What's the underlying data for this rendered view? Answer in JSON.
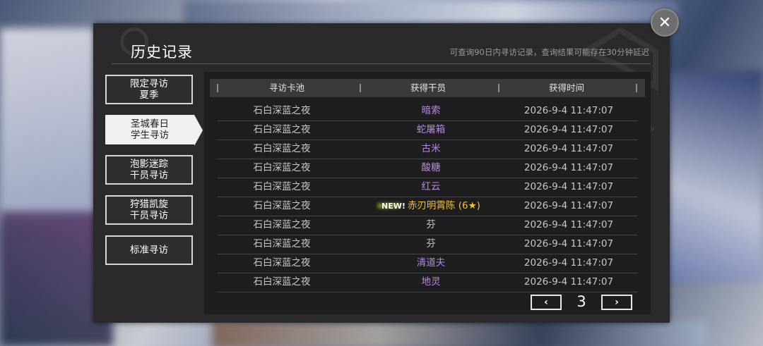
{
  "header": {
    "title": "历史记录",
    "hint": "可查询90日内寻访记录，查询结果可能存在30分钟延迟"
  },
  "close_icon": "✕",
  "tabs": [
    {
      "line1": "限定寻访",
      "line2": "夏季",
      "active": false
    },
    {
      "line1": "圣城春日",
      "line2": "学生寻访",
      "active": true
    },
    {
      "line1": "泡影迷踪",
      "line2": "干员寻访",
      "active": false
    },
    {
      "line1": "狩猎凯旋",
      "line2": "干员寻访",
      "active": false
    },
    {
      "line1": "标准寻访",
      "line2": "",
      "active": false
    }
  ],
  "table": {
    "headers": {
      "pool": "寻访卡池",
      "operator": "获得干员",
      "time": "获得时间"
    },
    "rows": [
      {
        "pool": "石白深蓝之夜",
        "operator": "暗索",
        "time": "2026-9-4 11:47:07"
      },
      {
        "pool": "石白深蓝之夜",
        "operator": "蛇屠箱",
        "time": "2026-9-4 11:47:07"
      },
      {
        "pool": "石白深蓝之夜",
        "operator": "古米",
        "time": "2026-9-4 11:47:07"
      },
      {
        "pool": "石白深蓝之夜",
        "operator": "酸糖",
        "time": "2026-9-4 11:47:07"
      },
      {
        "pool": "石白深蓝之夜",
        "operator": "红云",
        "time": "2026-9-4 11:47:07"
      },
      {
        "pool": "石白深蓝之夜",
        "operator": "赤刃明霄陈 (6★)",
        "time": "2026-9-4 11:47:07",
        "new": "NEW!"
      },
      {
        "pool": "石白深蓝之夜",
        "operator": "芬",
        "time": "2026-9-4 11:47:07"
      },
      {
        "pool": "石白深蓝之夜",
        "operator": "芬",
        "time": "2026-9-4 11:47:07"
      },
      {
        "pool": "石白深蓝之夜",
        "operator": "清道夫",
        "time": "2026-9-4 11:47:07"
      },
      {
        "pool": "石白深蓝之夜",
        "operator": "地灵",
        "time": "2026-9-4 11:47:07"
      }
    ]
  },
  "pagination": {
    "prev": "‹",
    "page": "3",
    "next": "›"
  },
  "colors": {
    "rarity4": "#b48ae0",
    "rarity6": "#f0c040",
    "rarity3": "#c8c8c8"
  }
}
